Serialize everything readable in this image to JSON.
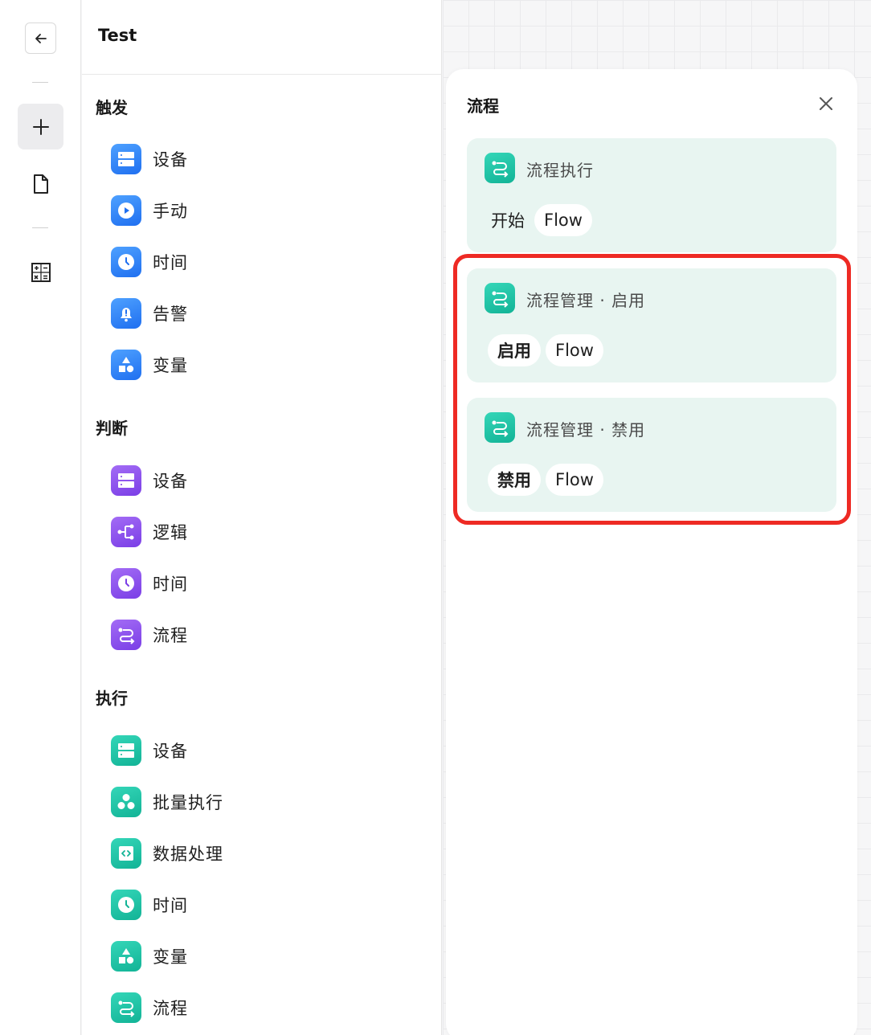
{
  "palette": {
    "title": "Test",
    "sections": [
      {
        "title": "触发",
        "items": [
          {
            "label": "设备",
            "icon": "server-icon"
          },
          {
            "label": "手动",
            "icon": "play-icon"
          },
          {
            "label": "时间",
            "icon": "clock-icon"
          },
          {
            "label": "告警",
            "icon": "alarm-bell-icon"
          },
          {
            "label": "变量",
            "icon": "shapes-icon"
          }
        ]
      },
      {
        "title": "判断",
        "items": [
          {
            "label": "设备",
            "icon": "server-icon"
          },
          {
            "label": "逻辑",
            "icon": "branch-icon"
          },
          {
            "label": "时间",
            "icon": "clock-icon"
          },
          {
            "label": "流程",
            "icon": "flow-icon"
          }
        ]
      },
      {
        "title": "执行",
        "items": [
          {
            "label": "设备",
            "icon": "server-icon"
          },
          {
            "label": "批量执行",
            "icon": "batch-icon"
          },
          {
            "label": "数据处理",
            "icon": "code-icon"
          },
          {
            "label": "时间",
            "icon": "clock-icon"
          },
          {
            "label": "变量",
            "icon": "shapes-icon"
          },
          {
            "label": "流程",
            "icon": "flow-icon"
          }
        ]
      }
    ]
  },
  "drawer": {
    "title": "流程",
    "cards": [
      {
        "title": "流程执行",
        "chips": [
          "开始",
          "Flow"
        ]
      },
      {
        "title": "流程管理 · 启用",
        "chips": [
          "启用",
          "Flow"
        ]
      },
      {
        "title": "流程管理 · 禁用",
        "chips": [
          "禁用",
          "Flow"
        ]
      }
    ]
  },
  "colors": {
    "trigger": "#2f86ff",
    "condition": "#8b50ee",
    "action": "#1cc4a5",
    "card_bg": "#e8f5f1",
    "highlight": "#ee2a24"
  }
}
